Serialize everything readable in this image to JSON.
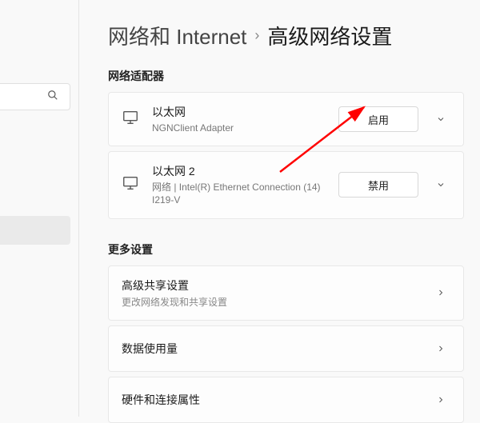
{
  "breadcrumb": {
    "parent": "网络和 Internet",
    "current": "高级网络设置"
  },
  "sections": {
    "adapters_title": "网络适配器",
    "more_title": "更多设置"
  },
  "adapters": [
    {
      "name": "以太网",
      "sub": "NGNClient Adapter",
      "action": "启用"
    },
    {
      "name": "以太网 2",
      "sub": "网络 | Intel(R) Ethernet Connection (14) I219-V",
      "action": "禁用"
    }
  ],
  "more": [
    {
      "title": "高级共享设置",
      "sub": "更改网络发现和共享设置"
    },
    {
      "title": "数据使用量",
      "sub": ""
    },
    {
      "title": "硬件和连接属性",
      "sub": ""
    }
  ]
}
